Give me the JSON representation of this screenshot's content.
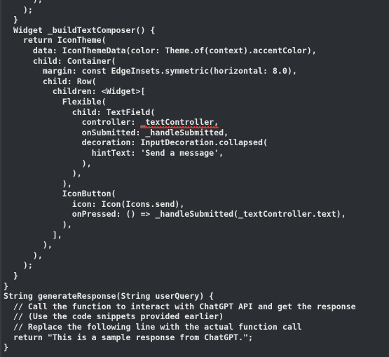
{
  "editor": {
    "language": "dart",
    "background_color": "#2b2f33",
    "text_color": "#e6e6e6",
    "error_underline_color": "#e03a2f",
    "gutter_edge_color": "#3a3f44",
    "lines": [
      {
        "text": "      ), "
      },
      {
        "text": "    );"
      },
      {
        "text": "  }"
      },
      {
        "text": "  Widget _buildTextComposer() {"
      },
      {
        "text": "    return IconTheme("
      },
      {
        "text": "      data: IconThemeData(color: Theme.of(context).accentColor),"
      },
      {
        "text": "      child: Container("
      },
      {
        "text": "        margin: const EdgeInsets.symmetric(horizontal: 8.0),"
      },
      {
        "text": "        child: Row("
      },
      {
        "text": "          children: <Widget>["
      },
      {
        "text": "            Flexible("
      },
      {
        "text": "              child: TextField("
      },
      {
        "text": "                controller: ",
        "error_text": "_textController,"
      },
      {
        "text": "                onSubmitted: _handleSubmitted,"
      },
      {
        "text": "                decoration: InputDecoration.collapsed("
      },
      {
        "text": "                  hintText: 'Send a message',"
      },
      {
        "text": "                ),"
      },
      {
        "text": "              ),"
      },
      {
        "text": "            ),"
      },
      {
        "text": "            IconButton("
      },
      {
        "text": "              icon: Icon(Icons.send),"
      },
      {
        "text": "              onPressed: () => _handleSubmitted(_textController.text),"
      },
      {
        "text": "            ),"
      },
      {
        "text": "          ],"
      },
      {
        "text": "        ),"
      },
      {
        "text": "      ),"
      },
      {
        "text": "    );"
      },
      {
        "text": "  }"
      },
      {
        "text": "}"
      },
      {
        "text": "String generateResponse(String userQuery) {"
      },
      {
        "text": "  // Call the function to interact with ChatGPT API and get the response"
      },
      {
        "text": "  // (Use the code snippets provided earlier)"
      },
      {
        "text": "  // Replace the following line with the actual function call"
      },
      {
        "text": "  return \"This is a sample response from ChatGPT.\";"
      },
      {
        "text": "}"
      }
    ]
  }
}
